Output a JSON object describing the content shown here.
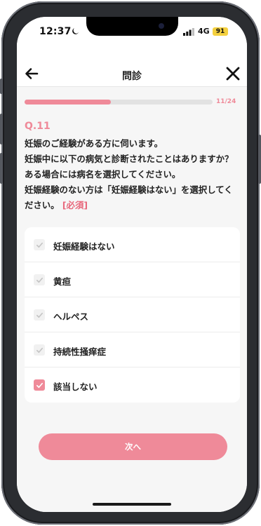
{
  "status_bar": {
    "time": "12:37",
    "network": "4G",
    "battery": "91"
  },
  "nav": {
    "title": "問診",
    "back_icon": "arrow-left-icon",
    "close_icon": "close-icon"
  },
  "progress": {
    "label": "11/24",
    "fraction": 0.458
  },
  "question": {
    "number": "Q.11",
    "lines": [
      "妊娠のご経験がある方に伺います。",
      "妊娠中に以下の病気と診断されたことはありますか？",
      "ある場合には病名を選択してください。",
      "妊娠経験のない方は「妊娠経験はない」を選択してく",
      "ださい。"
    ],
    "required_tag": "[必須]"
  },
  "options": [
    {
      "label": "妊娠経験はない",
      "checked": false
    },
    {
      "label": "黄疸",
      "checked": false
    },
    {
      "label": "ヘルペス",
      "checked": false
    },
    {
      "label": "持続性掻痒症",
      "checked": false
    },
    {
      "label": "該当しない",
      "checked": true
    }
  ],
  "next_button": {
    "label": "次へ"
  },
  "colors": {
    "accent": "#ef8a99",
    "background": "#f6f6f6"
  }
}
